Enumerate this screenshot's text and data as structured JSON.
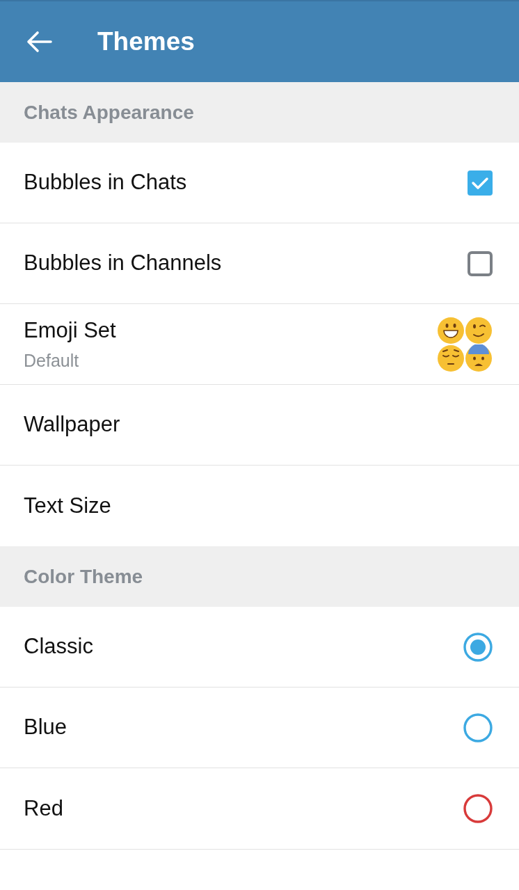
{
  "app_bar": {
    "title": "Themes"
  },
  "sections": [
    {
      "header": "Chats Appearance",
      "items": [
        {
          "kind": "checkbox",
          "label": "Bubbles in Chats",
          "checked": true
        },
        {
          "kind": "checkbox",
          "label": "Bubbles in Channels",
          "checked": false
        },
        {
          "kind": "emoji",
          "label": "Emoji Set",
          "value": "Default"
        },
        {
          "kind": "plain",
          "label": "Wallpaper"
        },
        {
          "kind": "plain",
          "label": "Text Size"
        }
      ]
    },
    {
      "header": "Color Theme",
      "items": [
        {
          "kind": "radio",
          "label": "Classic",
          "selected": true,
          "color": "#3ca9e2"
        },
        {
          "kind": "radio",
          "label": "Blue",
          "selected": false,
          "color": "#3ca9e2"
        },
        {
          "kind": "radio",
          "label": "Red",
          "selected": false,
          "color": "#d83a3a"
        }
      ]
    }
  ]
}
